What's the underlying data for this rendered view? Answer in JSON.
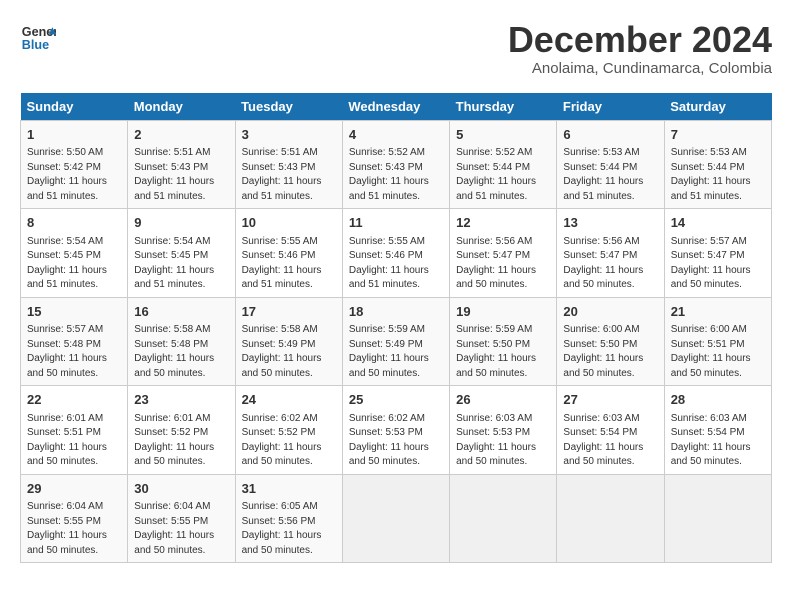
{
  "logo": {
    "line1": "General",
    "line2": "Blue"
  },
  "title": "December 2024",
  "subtitle": "Anolaima, Cundinamarca, Colombia",
  "days_of_week": [
    "Sunday",
    "Monday",
    "Tuesday",
    "Wednesday",
    "Thursday",
    "Friday",
    "Saturday"
  ],
  "weeks": [
    [
      {
        "day": 1,
        "sunrise": "5:50 AM",
        "sunset": "5:42 PM",
        "daylight": "11 hours and 51 minutes."
      },
      {
        "day": 2,
        "sunrise": "5:51 AM",
        "sunset": "5:43 PM",
        "daylight": "11 hours and 51 minutes."
      },
      {
        "day": 3,
        "sunrise": "5:51 AM",
        "sunset": "5:43 PM",
        "daylight": "11 hours and 51 minutes."
      },
      {
        "day": 4,
        "sunrise": "5:52 AM",
        "sunset": "5:43 PM",
        "daylight": "11 hours and 51 minutes."
      },
      {
        "day": 5,
        "sunrise": "5:52 AM",
        "sunset": "5:44 PM",
        "daylight": "11 hours and 51 minutes."
      },
      {
        "day": 6,
        "sunrise": "5:53 AM",
        "sunset": "5:44 PM",
        "daylight": "11 hours and 51 minutes."
      },
      {
        "day": 7,
        "sunrise": "5:53 AM",
        "sunset": "5:44 PM",
        "daylight": "11 hours and 51 minutes."
      }
    ],
    [
      {
        "day": 8,
        "sunrise": "5:54 AM",
        "sunset": "5:45 PM",
        "daylight": "11 hours and 51 minutes."
      },
      {
        "day": 9,
        "sunrise": "5:54 AM",
        "sunset": "5:45 PM",
        "daylight": "11 hours and 51 minutes."
      },
      {
        "day": 10,
        "sunrise": "5:55 AM",
        "sunset": "5:46 PM",
        "daylight": "11 hours and 51 minutes."
      },
      {
        "day": 11,
        "sunrise": "5:55 AM",
        "sunset": "5:46 PM",
        "daylight": "11 hours and 51 minutes."
      },
      {
        "day": 12,
        "sunrise": "5:56 AM",
        "sunset": "5:47 PM",
        "daylight": "11 hours and 50 minutes."
      },
      {
        "day": 13,
        "sunrise": "5:56 AM",
        "sunset": "5:47 PM",
        "daylight": "11 hours and 50 minutes."
      },
      {
        "day": 14,
        "sunrise": "5:57 AM",
        "sunset": "5:47 PM",
        "daylight": "11 hours and 50 minutes."
      }
    ],
    [
      {
        "day": 15,
        "sunrise": "5:57 AM",
        "sunset": "5:48 PM",
        "daylight": "11 hours and 50 minutes."
      },
      {
        "day": 16,
        "sunrise": "5:58 AM",
        "sunset": "5:48 PM",
        "daylight": "11 hours and 50 minutes."
      },
      {
        "day": 17,
        "sunrise": "5:58 AM",
        "sunset": "5:49 PM",
        "daylight": "11 hours and 50 minutes."
      },
      {
        "day": 18,
        "sunrise": "5:59 AM",
        "sunset": "5:49 PM",
        "daylight": "11 hours and 50 minutes."
      },
      {
        "day": 19,
        "sunrise": "5:59 AM",
        "sunset": "5:50 PM",
        "daylight": "11 hours and 50 minutes."
      },
      {
        "day": 20,
        "sunrise": "6:00 AM",
        "sunset": "5:50 PM",
        "daylight": "11 hours and 50 minutes."
      },
      {
        "day": 21,
        "sunrise": "6:00 AM",
        "sunset": "5:51 PM",
        "daylight": "11 hours and 50 minutes."
      }
    ],
    [
      {
        "day": 22,
        "sunrise": "6:01 AM",
        "sunset": "5:51 PM",
        "daylight": "11 hours and 50 minutes."
      },
      {
        "day": 23,
        "sunrise": "6:01 AM",
        "sunset": "5:52 PM",
        "daylight": "11 hours and 50 minutes."
      },
      {
        "day": 24,
        "sunrise": "6:02 AM",
        "sunset": "5:52 PM",
        "daylight": "11 hours and 50 minutes."
      },
      {
        "day": 25,
        "sunrise": "6:02 AM",
        "sunset": "5:53 PM",
        "daylight": "11 hours and 50 minutes."
      },
      {
        "day": 26,
        "sunrise": "6:03 AM",
        "sunset": "5:53 PM",
        "daylight": "11 hours and 50 minutes."
      },
      {
        "day": 27,
        "sunrise": "6:03 AM",
        "sunset": "5:54 PM",
        "daylight": "11 hours and 50 minutes."
      },
      {
        "day": 28,
        "sunrise": "6:03 AM",
        "sunset": "5:54 PM",
        "daylight": "11 hours and 50 minutes."
      }
    ],
    [
      {
        "day": 29,
        "sunrise": "6:04 AM",
        "sunset": "5:55 PM",
        "daylight": "11 hours and 50 minutes."
      },
      {
        "day": 30,
        "sunrise": "6:04 AM",
        "sunset": "5:55 PM",
        "daylight": "11 hours and 50 minutes."
      },
      {
        "day": 31,
        "sunrise": "6:05 AM",
        "sunset": "5:56 PM",
        "daylight": "11 hours and 50 minutes."
      },
      null,
      null,
      null,
      null
    ]
  ]
}
